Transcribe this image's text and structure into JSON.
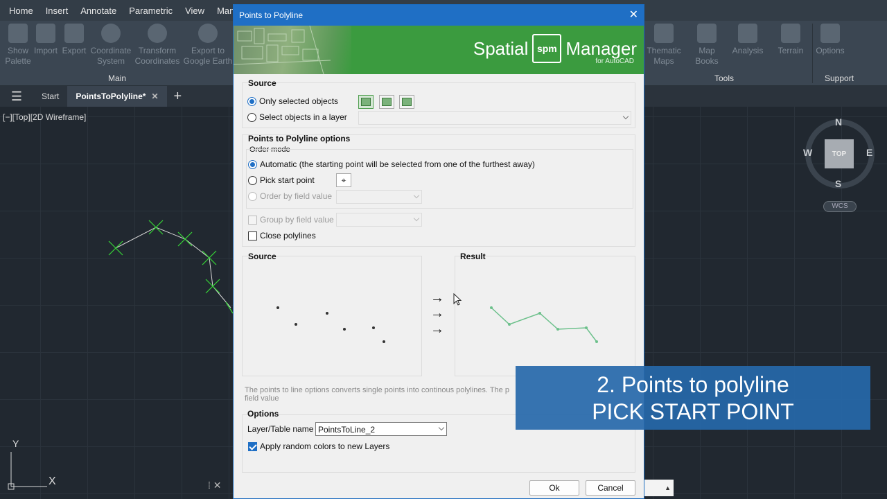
{
  "menubar": {
    "tabs": [
      "Home",
      "Insert",
      "Annotate",
      "Parametric",
      "View",
      "Mana"
    ]
  },
  "ribbon": {
    "left_buttons": [
      {
        "label": "Show\nPalette",
        "icon": "spm-palette-icon"
      },
      {
        "label": "Import",
        "icon": "import-icon"
      },
      {
        "label": "Export",
        "icon": "export-icon"
      },
      {
        "label": "Coordinate\nSystem",
        "icon": "globe-icon"
      },
      {
        "label": "Transform\nCoordinates",
        "icon": "transform-globe-icon"
      },
      {
        "label": "Export to\nGoogle Earth",
        "icon": "google-earth-icon"
      }
    ],
    "right_buttons": [
      {
        "label": "Thematic\nMaps",
        "icon": "thematic-maps-icon"
      },
      {
        "label": "Map\nBooks",
        "icon": "map-books-icon"
      },
      {
        "label": "Analysis",
        "icon": "analysis-icon"
      },
      {
        "label": "Terrain",
        "icon": "terrain-icon"
      },
      {
        "label": "Options",
        "icon": "options-icon"
      }
    ],
    "panels": {
      "main": "Main",
      "tools": "Tools",
      "support": "Support"
    }
  },
  "docbar": {
    "tabs": [
      "Start",
      "PointsToPolyline*"
    ],
    "close": "✕",
    "add": "+"
  },
  "viewport": {
    "label": "[−][Top][2D Wireframe]"
  },
  "viewcube": {
    "top": "TOP",
    "n": "N",
    "s": "S",
    "e": "E",
    "w": "W",
    "wcs": "WCS"
  },
  "ucs": {
    "y": "Y",
    "x": "X"
  },
  "dialog": {
    "title": "Points to Polyline",
    "brand": {
      "left": "Spatial",
      "logo": "spm",
      "right": "Manager",
      "sub": "for AutoCAD"
    },
    "source": {
      "title": "Source",
      "only_selected": "Only selected objects",
      "select_in_layer": "Select objects in a layer"
    },
    "options_group": {
      "title": "Points to Polyline options",
      "order_mode": "Order mode",
      "automatic": "Automatic (the starting point will be selected from one of the furthest away)",
      "pick_start": "Pick start point",
      "order_by_field": "Order by field value",
      "group_by_field": "Group by field value",
      "close_polylines": "Close polylines"
    },
    "preview": {
      "source_title": "Source",
      "result_title": "Result",
      "arrows": [
        "→",
        "→",
        "→"
      ]
    },
    "description": "The points to line options converts single points into continous polylines. The p",
    "description_line2": "field value",
    "options": {
      "title": "Options",
      "layer_label": "Layer/Table name",
      "layer_value": "PointsToLine_2",
      "random_colors": "Apply random colors to new Layers"
    },
    "ok": "Ok",
    "cancel": "Cancel"
  },
  "caption": {
    "line1": "2. Points to polyline",
    "line2": "PICK START POINT"
  }
}
